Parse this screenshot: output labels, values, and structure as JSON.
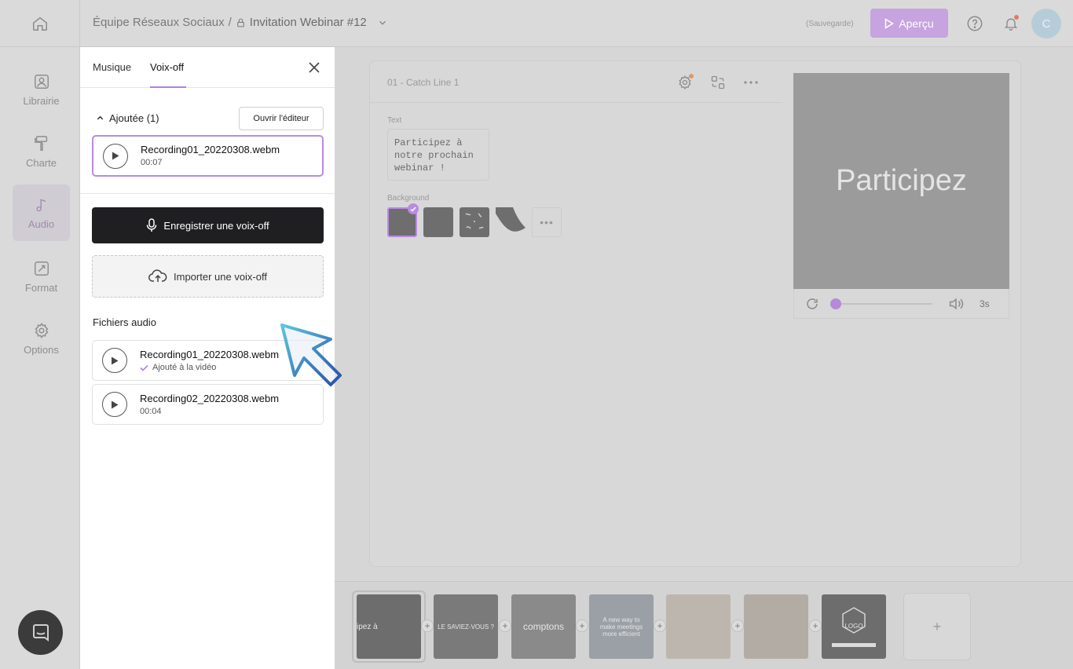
{
  "header": {
    "team": "Équipe Réseaux Sociaux",
    "separator": "/",
    "project": "Invitation Webinar #12",
    "saving_status": "(Sauvegarde)",
    "preview_label": "Aperçu",
    "avatar_initial": "C"
  },
  "leftnav": {
    "items": [
      {
        "label": "Librairie",
        "icon": "library-icon"
      },
      {
        "label": "Charte",
        "icon": "paint-roller-icon"
      },
      {
        "label": "Audio",
        "icon": "music-note-icon",
        "active": true
      },
      {
        "label": "Format",
        "icon": "format-icon"
      },
      {
        "label": "Options",
        "icon": "gear-icon"
      }
    ]
  },
  "panel": {
    "tabs": [
      {
        "label": "Musique"
      },
      {
        "label": "Voix-off",
        "active": true
      }
    ],
    "added_header": "Ajoutée (1)",
    "open_editor_label": "Ouvrir l'éditeur",
    "added_recordings": [
      {
        "name": "Recording01_20220308.webm",
        "duration": "00:07"
      }
    ],
    "record_label": "Enregistrer une voix-off",
    "import_label": "Importer une voix-off",
    "files_title": "Fichiers audio",
    "files": [
      {
        "name": "Recording01_20220308.webm",
        "status": "Ajouté à la vidéo"
      },
      {
        "name": "Recording02_20220308.webm",
        "duration": "00:04"
      }
    ]
  },
  "editor": {
    "scene_title": "01 - Catch Line 1",
    "text_label": "Text",
    "text_value": "Participez à\nnotre prochain\nwebinar !",
    "background_label": "Background",
    "preview_text": "Participez",
    "player_duration": "3s",
    "player_progress": 0
  },
  "timeline": {
    "thumbs": [
      {
        "label": "ipez à"
      },
      {
        "label": "LE SAVIEZ-VOUS ?"
      },
      {
        "label": "comptons"
      },
      {
        "label": "A new way to make meetings more efficient"
      },
      {
        "label": ""
      },
      {
        "label": ""
      },
      {
        "label": "LOGO"
      }
    ],
    "add_label": "+"
  },
  "colors": {
    "accent": "#b37ee0",
    "primary_button": "#1f1f22"
  }
}
